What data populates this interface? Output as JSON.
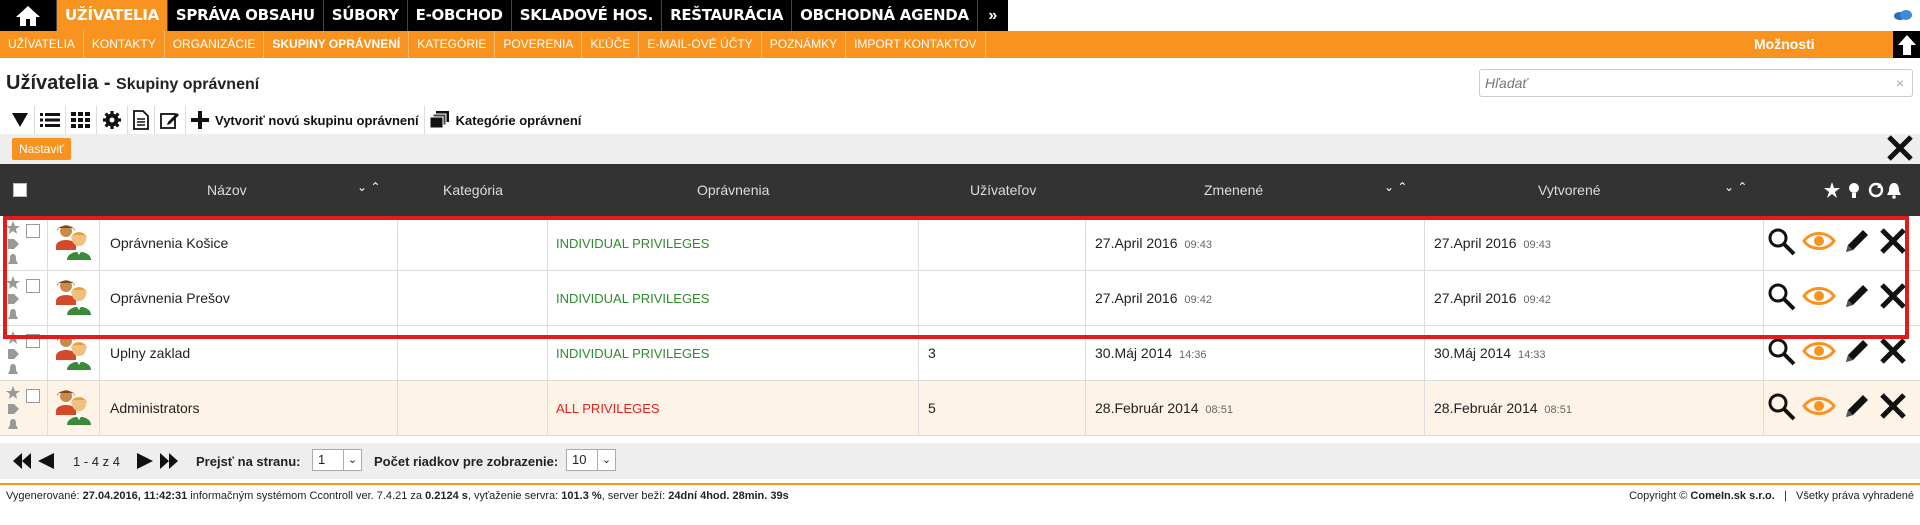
{
  "topnav": {
    "items": [
      {
        "label": "UŽÍVATELIA",
        "active": true
      },
      {
        "label": "SPRÁVA OBSAHU"
      },
      {
        "label": "SÚBORY"
      },
      {
        "label": "E-OBCHOD"
      },
      {
        "label": "SKLADOVÉ HOS."
      },
      {
        "label": "REŠTAURÁCIA"
      },
      {
        "label": "OBCHODNÁ AGENDA"
      }
    ],
    "more": "»"
  },
  "subnav": {
    "items": [
      {
        "label": "UŽÍVATELIA"
      },
      {
        "label": "KONTAKTY"
      },
      {
        "label": "ORGANIZÁCIE"
      },
      {
        "label": "SKUPINY OPRÁVNENÍ",
        "active": true
      },
      {
        "label": "KATEGÓRIE"
      },
      {
        "label": "POVERENIA"
      },
      {
        "label": "KĽÚČE"
      },
      {
        "label": "E-MAIL-OVÉ ÚČTY"
      },
      {
        "label": "POZNÁMKY"
      },
      {
        "label": "IMPORT KONTAKTOV"
      }
    ],
    "options_label": "Možnosti"
  },
  "page": {
    "title": "Užívatelia",
    "separator": " - ",
    "subtitle": "Skupiny oprávnení"
  },
  "search": {
    "placeholder": "Hľadať",
    "clear": "×"
  },
  "toolbar": {
    "create_label": "Vytvoriť novú skupinu oprávnení",
    "categories_label": "Kategórie oprávnení"
  },
  "setbar": {
    "set_label": "Nastaviť"
  },
  "table": {
    "headers": {
      "name": "Názov",
      "category": "Kategória",
      "privileges": "Oprávnenia",
      "users": "Užívateľov",
      "changed": "Zmenené",
      "created": "Vytvorené"
    },
    "rows": [
      {
        "name": "Oprávnenia Košice",
        "category": "",
        "privileges": "INDIVIDUAL PRIVILEGES",
        "privilege_color": "#2e8b2e",
        "users": "",
        "changed_date": "27.April 2016",
        "changed_time": "09:43",
        "created_date": "27.April 2016",
        "created_time": "09:43"
      },
      {
        "name": "Oprávnenia Prešov",
        "category": "",
        "privileges": "INDIVIDUAL PRIVILEGES",
        "privilege_color": "#2e8b2e",
        "users": "",
        "changed_date": "27.April 2016",
        "changed_time": "09:42",
        "created_date": "27.April 2016",
        "created_time": "09:42"
      },
      {
        "name": "Uplny zaklad",
        "category": "",
        "privileges": "INDIVIDUAL PRIVILEGES",
        "privilege_color": "#2e8b2e",
        "users": "3",
        "changed_date": "30.Máj 2014",
        "changed_time": "14:36",
        "created_date": "30.Máj 2014",
        "created_time": "14:33"
      },
      {
        "name": "Administrators",
        "category": "",
        "privileges": "ALL PRIVILEGES",
        "privilege_color": "#e32222",
        "users": "5",
        "changed_date": "28.Február 2014",
        "changed_time": "08:51",
        "created_date": "28.Február 2014",
        "created_time": "08:51"
      }
    ]
  },
  "pager": {
    "range": "1 - 4 z 4",
    "goto_label": "Prejsť na stranu:",
    "page_value": "1",
    "rows_label": "Počet riadkov pre zobrazenie:",
    "rows_value": "10"
  },
  "footer": {
    "left_prefix": "Vygenerované: ",
    "generated": "27.04.2016, 11:42:31",
    "left_mid": " informačným systémom Ccontroll ver. 7.4.21 za ",
    "gen_time": "0.2124 s",
    "left_load": ", vyťaženie servra: ",
    "load": "101.3 %",
    "left_uptime": ", server beží: ",
    "uptime": "24dní 4hod. 28min. 39s",
    "copyright_prefix": "Copyright © ",
    "company": "ComeIn.sk s.r.o.",
    "sep": "|",
    "rights": "Všetky práva vyhradené"
  },
  "colors": {
    "accent": "#f7931e",
    "highlight": "#e31b1b"
  }
}
